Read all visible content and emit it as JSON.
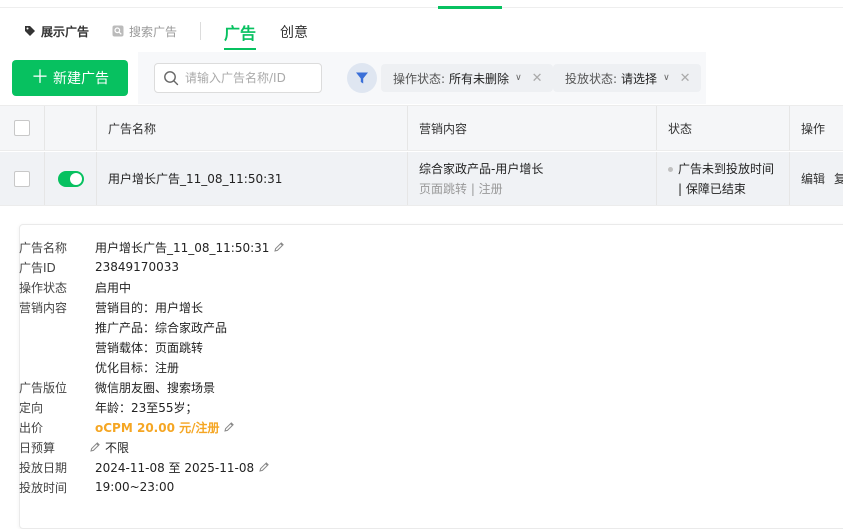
{
  "header": {
    "subtabs": [
      {
        "label": "展示广告",
        "active": true
      },
      {
        "label": "搜索广告",
        "active": false
      }
    ],
    "tabs": [
      {
        "label": "广告",
        "active": true
      },
      {
        "label": "创意",
        "active": false
      }
    ]
  },
  "toolbar": {
    "new_button": "新建广告",
    "search_placeholder": "请输入广告名称/ID",
    "filters": [
      {
        "label": "操作状态:",
        "value": "所有未删除"
      },
      {
        "label": "投放状态:",
        "value": "请选择"
      }
    ]
  },
  "table": {
    "columns": [
      "广告名称",
      "营销内容",
      "状态",
      "操作"
    ],
    "rows": [
      {
        "enabled": true,
        "name": "用户增长广告_11_08_11:50:31",
        "marketing_title": "综合家政产品-用户增长",
        "marketing_sub": "页面跳转 | 注册",
        "status_line1": "广告未到投放时间",
        "status_line2": "| 保障已结束",
        "actions": [
          "编辑",
          "复"
        ]
      }
    ]
  },
  "detail": {
    "name_label": "广告名称",
    "name_value": "用户增长广告_11_08_11:50:31",
    "id_label": "广告ID",
    "id_value": "23849170033",
    "opstatus_label": "操作状态",
    "opstatus_value": "启用中",
    "marketing_label": "营销内容",
    "marketing_goal": "营销目的：用户增长",
    "marketing_product": "推广产品：综合家政产品",
    "marketing_carrier": "营销载体：页面跳转",
    "marketing_target": "优化目标：注册",
    "placement_label": "广告版位",
    "placement_value": "微信朋友圈、搜索场景",
    "targeting_label": "定向",
    "targeting_value": "年龄：23至55岁；",
    "bid_label": "出价",
    "bid_value": "oCPM 20.00 元/注册",
    "budget_label": "日预算",
    "budget_value": "不限",
    "date_label": "投放日期",
    "date_value": "2024-11-08 至 2025-11-08",
    "time_label": "投放时间",
    "time_value": "19:00~23:00"
  },
  "colors": {
    "brand": "#07c160",
    "bid": "#f5a623"
  }
}
